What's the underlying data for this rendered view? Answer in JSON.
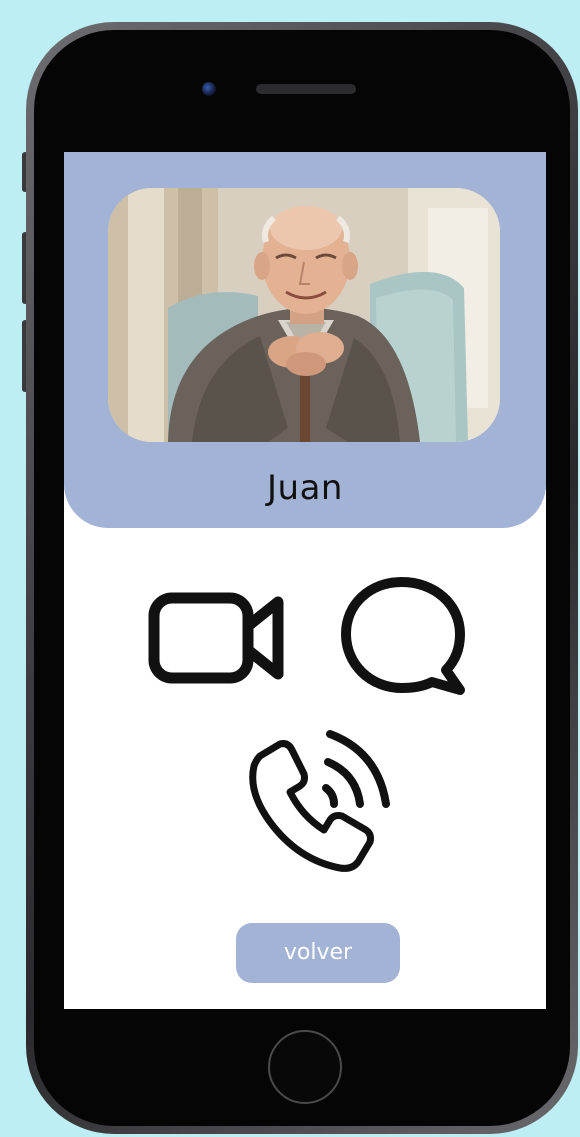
{
  "contact": {
    "name": "Juan",
    "photo_icon": "elderly-man-portrait-photo"
  },
  "actions": {
    "video_icon": "video-camera-icon",
    "chat_icon": "chat-bubble-icon",
    "call_icon": "phone-ringing-icon"
  },
  "footer": {
    "back_label": "volver"
  },
  "colors": {
    "background": "#bdeef4",
    "header": "#a3b3d6",
    "button": "#a3b3d6",
    "icon_stroke": "#111111"
  }
}
